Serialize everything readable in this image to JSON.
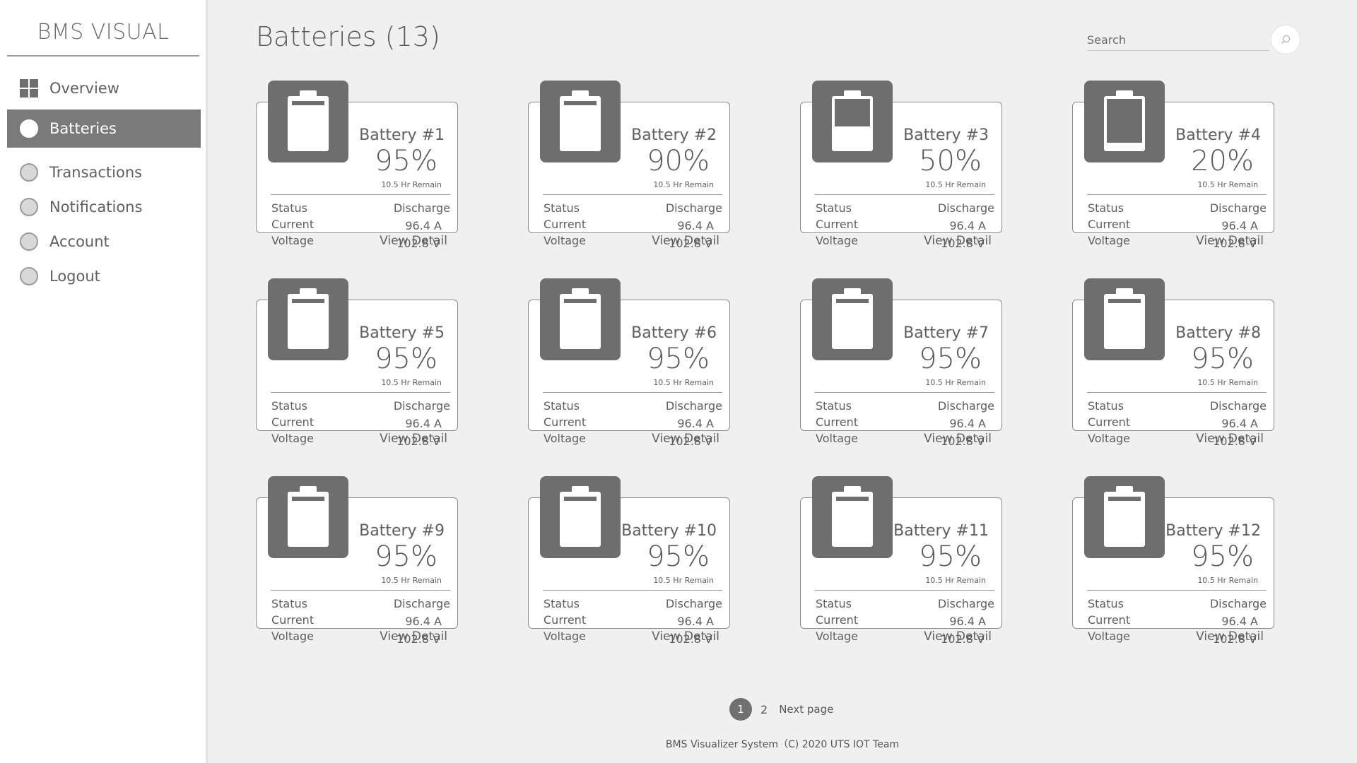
{
  "app": {
    "brand": "BMS VISUAL"
  },
  "sidebar": {
    "items": [
      {
        "label": "Overview",
        "icon": "grid-icon",
        "active": false
      },
      {
        "label": "Batteries",
        "icon": "circle-icon",
        "active": true
      },
      {
        "label": "Transactions",
        "icon": "circle-icon",
        "active": false
      },
      {
        "label": "Notifications",
        "icon": "circle-icon",
        "active": false
      },
      {
        "label": "Account",
        "icon": "circle-icon",
        "active": false
      },
      {
        "label": "Logout",
        "icon": "circle-icon",
        "active": false
      }
    ]
  },
  "header": {
    "title": "Batteries (13)"
  },
  "search": {
    "placeholder": "Search",
    "value": ""
  },
  "labels": {
    "status": "Status",
    "current": "Current",
    "voltage": "Voltage",
    "view_detail": "View Detail"
  },
  "batteries": [
    {
      "name": "Battery #1",
      "percent": "95%",
      "charge_level": 0.95,
      "remain": "10.5 Hr Remain",
      "status": "Discharge",
      "current": "96.4 A",
      "voltage": "102.8 V"
    },
    {
      "name": "Battery #2",
      "percent": "90%",
      "charge_level": 0.9,
      "remain": "10.5 Hr Remain",
      "status": "Discharge",
      "current": "96.4 A",
      "voltage": "102.8 V"
    },
    {
      "name": "Battery #3",
      "percent": "50%",
      "charge_level": 0.5,
      "remain": "10.5 Hr Remain",
      "status": "Discharge",
      "current": "96.4 A",
      "voltage": "102.8 V"
    },
    {
      "name": "Battery #4",
      "percent": "20%",
      "charge_level": 0.2,
      "remain": "10.5 Hr Remain",
      "status": "Discharge",
      "current": "96.4 A",
      "voltage": "102.8 V"
    },
    {
      "name": "Battery #5",
      "percent": "95%",
      "charge_level": 0.95,
      "remain": "10.5 Hr Remain",
      "status": "Discharge",
      "current": "96.4 A",
      "voltage": "102.8 V"
    },
    {
      "name": "Battery #6",
      "percent": "95%",
      "charge_level": 0.95,
      "remain": "10.5 Hr Remain",
      "status": "Discharge",
      "current": "96.4 A",
      "voltage": "102.8 V"
    },
    {
      "name": "Battery #7",
      "percent": "95%",
      "charge_level": 0.95,
      "remain": "10.5 Hr Remain",
      "status": "Discharge",
      "current": "96.4 A",
      "voltage": "102.8 V"
    },
    {
      "name": "Battery #8",
      "percent": "95%",
      "charge_level": 0.95,
      "remain": "10.5 Hr Remain",
      "status": "Discharge",
      "current": "96.4 A",
      "voltage": "102.8 V"
    },
    {
      "name": "Battery #9",
      "percent": "95%",
      "charge_level": 0.95,
      "remain": "10.5 Hr Remain",
      "status": "Discharge",
      "current": "96.4 A",
      "voltage": "102.8 V"
    },
    {
      "name": "Battery #10",
      "percent": "95%",
      "charge_level": 0.95,
      "remain": "10.5 Hr Remain",
      "status": "Discharge",
      "current": "96.4 A",
      "voltage": "102.8 V"
    },
    {
      "name": "Battery #11",
      "percent": "95%",
      "charge_level": 0.95,
      "remain": "10.5 Hr Remain",
      "status": "Discharge",
      "current": "96.4 A",
      "voltage": "102.8 V"
    },
    {
      "name": "Battery #12",
      "percent": "95%",
      "charge_level": 0.95,
      "remain": "10.5 Hr Remain",
      "status": "Discharge",
      "current": "96.4 A",
      "voltage": "102.8 V"
    }
  ],
  "pagination": {
    "current": "1",
    "next_number": "2",
    "next_label": "Next page"
  },
  "footer": {
    "text": "BMS Visualizer System（C) 2020 UTS IOT Team"
  },
  "colors": {
    "accent": "#707070",
    "tile": "#6e6e6e",
    "background": "#f0f0f0"
  }
}
